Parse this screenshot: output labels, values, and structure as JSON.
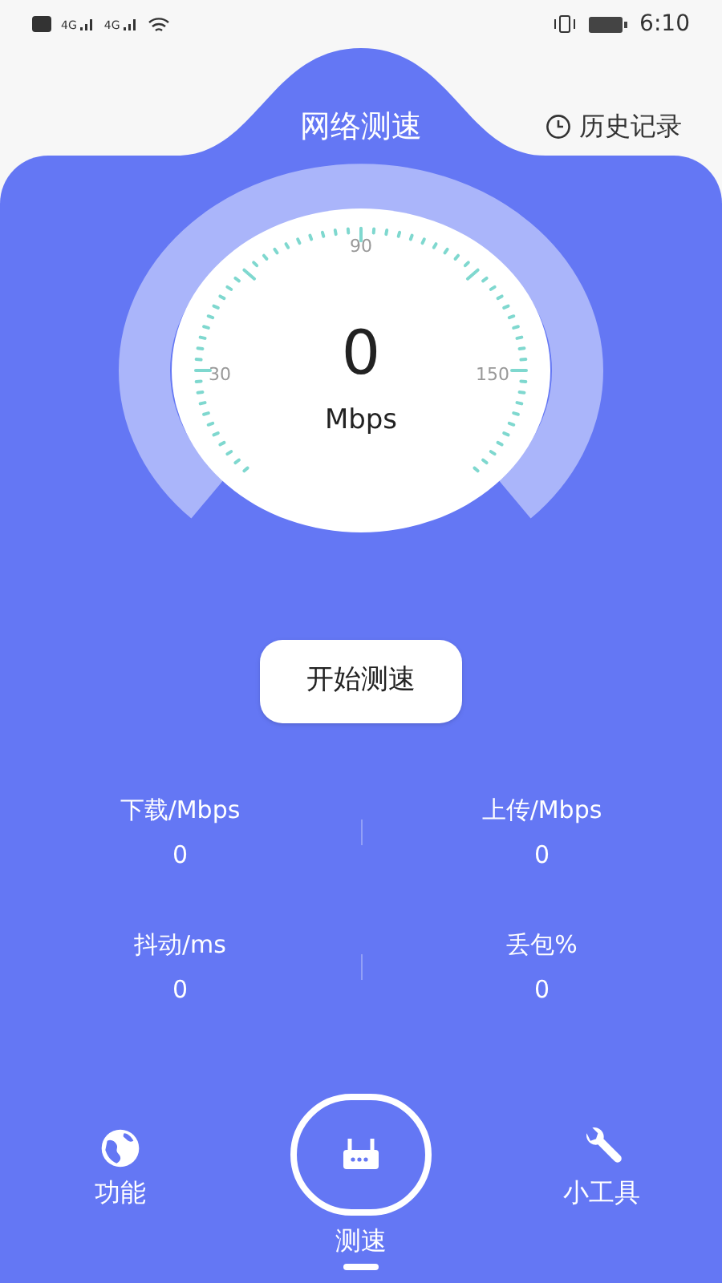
{
  "status_bar": {
    "network_labels": [
      "4G",
      "4G"
    ],
    "time": "6:10"
  },
  "header": {
    "title": "网络测速",
    "history_link": "历史记录"
  },
  "gauge": {
    "value": "0",
    "unit": "Mbps",
    "scale_labels": [
      "30",
      "90",
      "150"
    ]
  },
  "start_button": "开始测速",
  "stats": [
    {
      "label": "下载/Mbps",
      "value": "0"
    },
    {
      "label": "上传/Mbps",
      "value": "0"
    },
    {
      "label": "抖动/ms",
      "value": "0"
    },
    {
      "label": "丢包%",
      "value": "0"
    }
  ],
  "nav": [
    {
      "label": "功能",
      "selected": false,
      "kind": "globe"
    },
    {
      "label": "测速",
      "selected": true,
      "kind": "router"
    },
    {
      "label": "小工具",
      "selected": false,
      "kind": "wrench"
    }
  ]
}
